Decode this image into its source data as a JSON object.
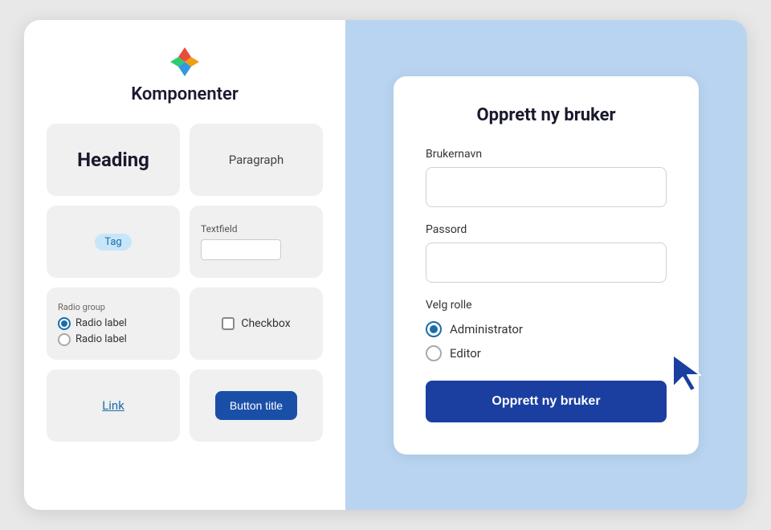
{
  "app": {
    "title": "Komponenter",
    "logo_alt": "app-logo"
  },
  "left_panel": {
    "components": [
      {
        "id": "heading",
        "label": "Heading"
      },
      {
        "id": "paragraph",
        "label": "Paragraph"
      },
      {
        "id": "tag",
        "label": "Tag"
      },
      {
        "id": "textfield",
        "label": "Textfield"
      },
      {
        "id": "radio",
        "label": "Radio group"
      },
      {
        "id": "checkbox",
        "label": "Checkbox"
      },
      {
        "id": "link",
        "label": "Link"
      },
      {
        "id": "button",
        "label": "Button title"
      }
    ],
    "radio_group_label": "Radio group",
    "radio_item1": "Radio label",
    "radio_item2": "Radio label",
    "tag_text": "Tag",
    "textfield_label": "Textfield",
    "checkbox_label": "Checkbox",
    "link_label": "Link"
  },
  "form": {
    "title": "Opprett ny bruker",
    "username_label": "Brukernavn",
    "username_placeholder": "",
    "password_label": "Passord",
    "password_placeholder": "",
    "role_label": "Velg rolle",
    "role_options": [
      {
        "id": "administrator",
        "label": "Administrator",
        "selected": true
      },
      {
        "id": "editor",
        "label": "Editor",
        "selected": false
      }
    ],
    "submit_label": "Opprett ny bruker"
  }
}
